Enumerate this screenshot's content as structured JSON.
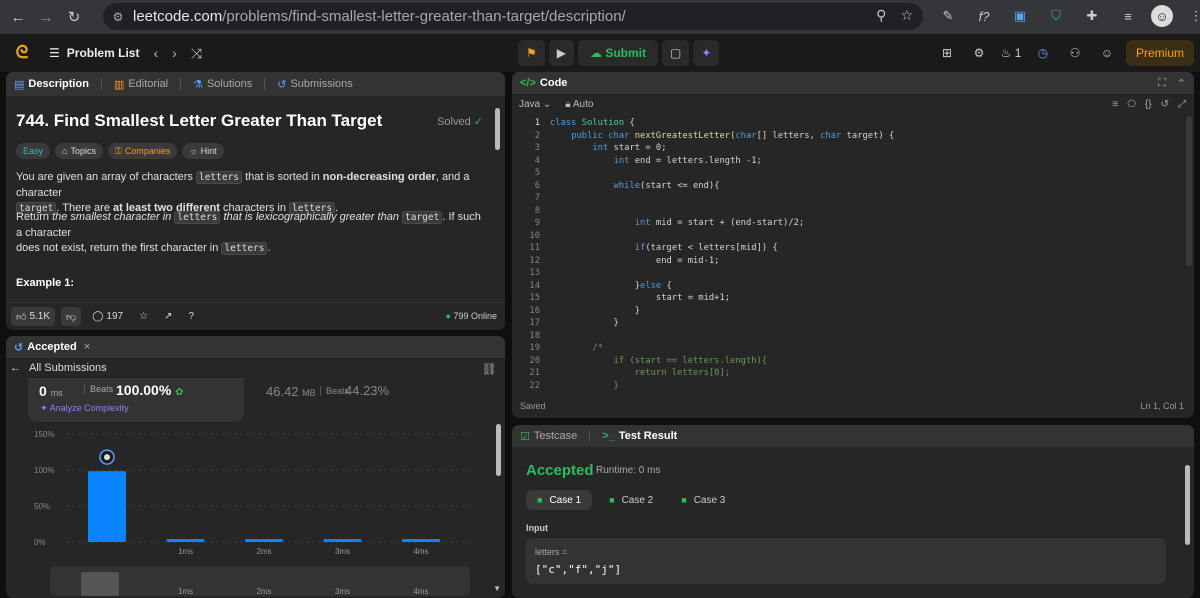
{
  "browser": {
    "url_host": "leetcode.com",
    "url_path": "/problems/find-smallest-letter-greater-than-target/description/"
  },
  "nav": {
    "problem_list": "Problem List",
    "submit": "Submit",
    "streak": "1",
    "premium": "Premium"
  },
  "description": {
    "tabs": [
      "Description",
      "Editorial",
      "Solutions",
      "Submissions"
    ],
    "title": "744. Find Smallest Letter Greater Than Target",
    "status": "Solved",
    "tags": [
      "Easy",
      "Topics",
      "Companies",
      "Hint"
    ],
    "p1_a": "You are given an array of characters ",
    "p1_code1": "letters",
    "p1_b": " that is sorted in ",
    "p1_bold1": "non-decreasing order",
    "p1_c": ", and a character",
    "p1_code2": "target",
    "p1_d": ". There are ",
    "p1_bold2": "at least two different",
    "p1_e": " characters in ",
    "p1_code3": "letters",
    "p1_f": ".",
    "p2_a": "Return ",
    "p2_i1": "the smallest character in ",
    "p2_code1": "letters",
    "p2_i2": " that is lexicographically greater than ",
    "p2_code2": "target",
    "p2_b": ". If such a character",
    "p2_c": "does not exist, return the first character in ",
    "p2_code3": "letters",
    "p2_d": ".",
    "example_heading": "Example 1:",
    "likes": "5.1K",
    "comments": "197",
    "online": "799 Online"
  },
  "accepted": {
    "tab": "Accepted",
    "all_submissions": "All Submissions",
    "runtime_value": "0",
    "runtime_unit": "ms",
    "beats_label": "Beats",
    "runtime_beats": "100.00%",
    "analyze": "Analyze Complexity",
    "memory_value": "46.42",
    "memory_unit": "MB",
    "memory_beats": "44.23%"
  },
  "chart_data": {
    "type": "bar",
    "title": "",
    "xlabel": "",
    "ylabel": "",
    "y_ticks": [
      "150%",
      "100%",
      "50%",
      "0%"
    ],
    "ylim": [
      0,
      150
    ],
    "categories": [
      "",
      "1ms",
      "2ms",
      "3ms",
      "4ms"
    ],
    "values": [
      98.5,
      0.6,
      0.4,
      0.3,
      0.2
    ],
    "highlight_index": 0,
    "color": "#0a84ff",
    "minimap_labels": [
      "1ms",
      "2ms",
      "3ms",
      "4ms"
    ]
  },
  "code": {
    "tab": "Code",
    "language": "Java",
    "mode": "Auto",
    "saved": "Saved",
    "cursor": "Ln 1, Col 1",
    "lines": [
      "class Solution {",
      "    public char nextGreatestLetter(char[] letters, char target) {",
      "        int start = 0;",
      "            int end = letters.length -1;",
      "",
      "            while(start <= end){",
      "",
      "",
      "                int mid = start + (end-start)/2;",
      "",
      "                if(target < letters[mid]) {",
      "                    end = mid-1;",
      "",
      "                }else {",
      "                    start = mid+1;",
      "                }",
      "            }",
      "",
      "        /*",
      "            if (start == letters.length){",
      "                return letters[0];",
      "            }"
    ]
  },
  "test": {
    "tab_testcase": "Testcase",
    "tab_result": "Test Result",
    "status": "Accepted",
    "runtime": "Runtime: 0 ms",
    "cases": [
      "Case 1",
      "Case 2",
      "Case 3"
    ],
    "input_label": "Input",
    "input_name": "letters =",
    "input_value": "[\"c\",\"f\",\"j\"]"
  }
}
